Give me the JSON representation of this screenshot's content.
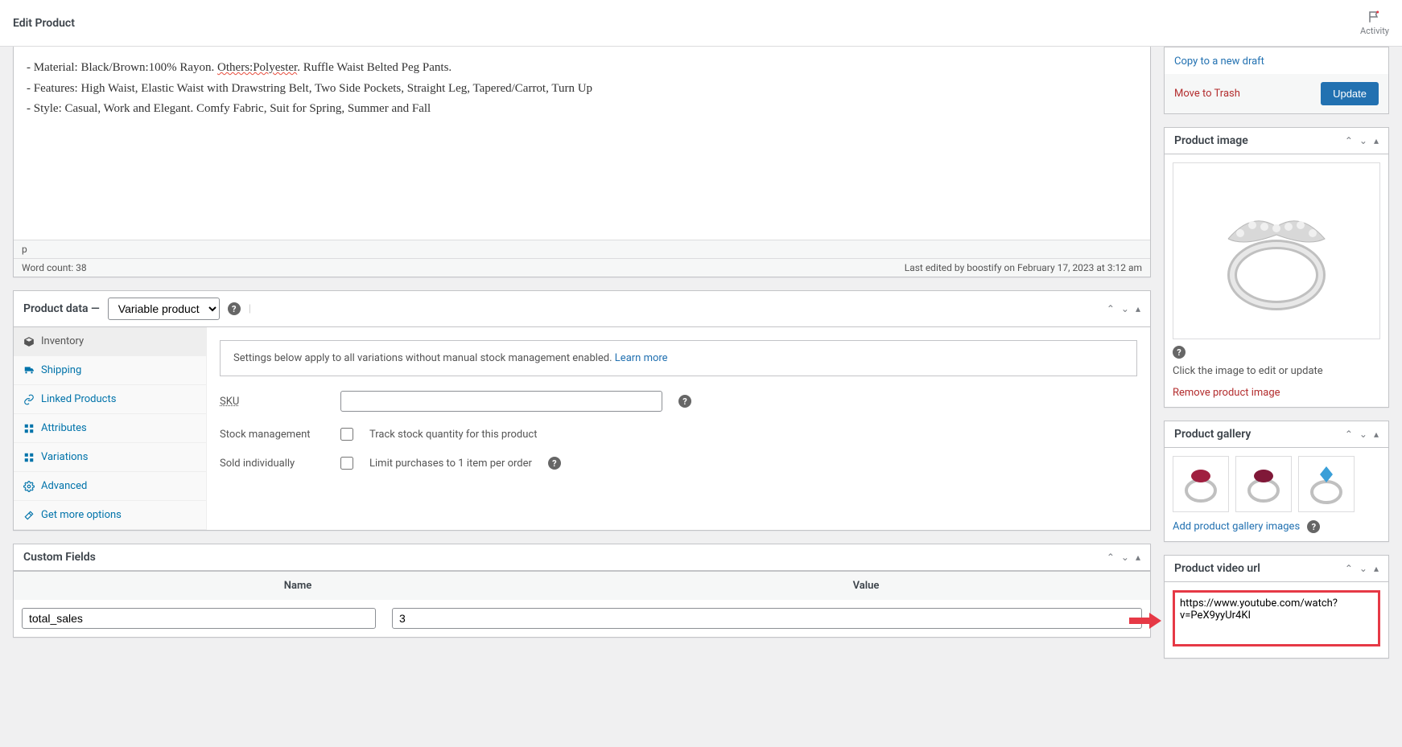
{
  "header": {
    "title": "Edit Product",
    "activity_label": "Activity"
  },
  "editor": {
    "lines": [
      {
        "pre": "- Material: Black/Brown:100% Rayon. ",
        "u": "Others:Polyester",
        "post": ". Ruffle Waist Belted Peg Pants."
      },
      {
        "pre": "- Features: High Waist, Elastic Waist with Drawstring Belt, Two Side Pockets, Straight Leg, Tapered/Carrot, Turn Up",
        "u": "",
        "post": ""
      },
      {
        "pre": "- Style: Casual, Work and Elegant. Comfy Fabric, Suit for Spring, Summer and Fall",
        "u": "",
        "post": ""
      }
    ],
    "path": "p",
    "wordcount": "Word count: 38",
    "lastedit": "Last edited by boostify on February 17, 2023 at 3:12 am"
  },
  "product_data": {
    "title": "Product data",
    "dash": "—",
    "type_selected": "Variable product",
    "tabs": {
      "inventory": "Inventory",
      "shipping": "Shipping",
      "linked": "Linked Products",
      "attributes": "Attributes",
      "variations": "Variations",
      "advanced": "Advanced",
      "more": "Get more options"
    },
    "notice": "Settings below apply to all variations without manual stock management enabled. ",
    "notice_link": "Learn more",
    "sku_label": "SKU",
    "stock_mgmt_label": "Stock management",
    "stock_mgmt_cb": "Track stock quantity for this product",
    "sold_ind_label": "Sold individually",
    "sold_ind_cb": "Limit purchases to 1 item per order"
  },
  "custom_fields": {
    "title": "Custom Fields",
    "col_name": "Name",
    "col_value": "Value",
    "row_name": "total_sales",
    "row_value": "3"
  },
  "publish": {
    "copy": "Copy to a new draft",
    "trash": "Move to Trash",
    "update": "Update"
  },
  "product_image": {
    "title": "Product image",
    "note": "Click the image to edit or update",
    "remove": "Remove product image"
  },
  "gallery": {
    "title": "Product gallery",
    "add": "Add product gallery images"
  },
  "video": {
    "title": "Product video url",
    "value": "https://www.youtube.com/watch?v=PeX9yyUr4KI"
  }
}
